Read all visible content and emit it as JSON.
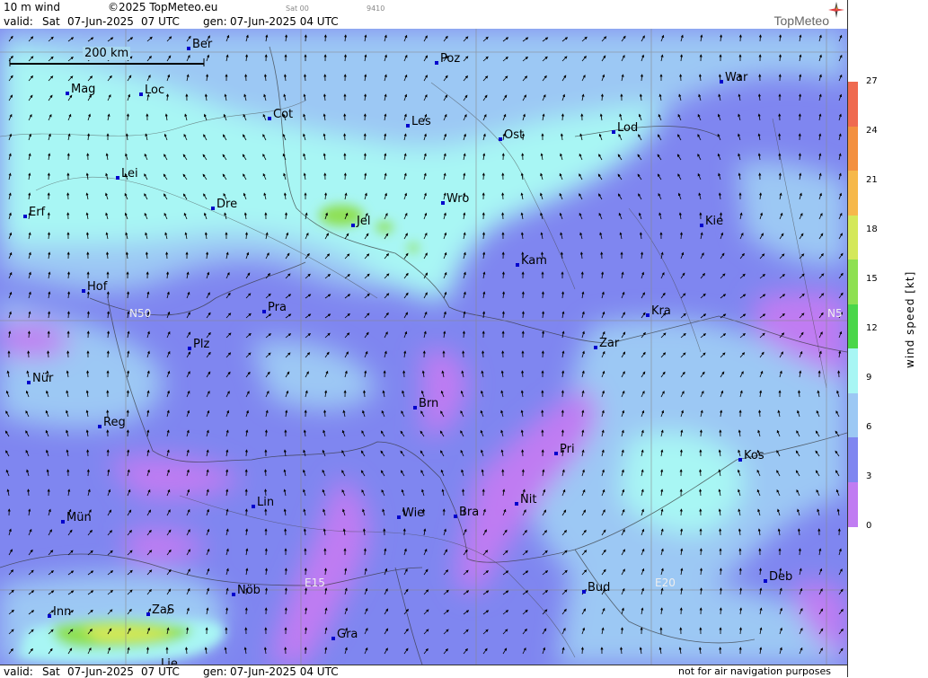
{
  "header": {
    "param": "10 m wind",
    "copyright": "©2025 TopMeteo.eu",
    "sat": "Sat 00",
    "code": "9410",
    "valid_label": "valid:",
    "valid_day": "Sat",
    "valid_date": "07-Jun-2025",
    "valid_time": "07 UTC",
    "gen_label": "gen:",
    "gen_date": "07-Jun-2025 04 UTC",
    "logo": "TopMeteo"
  },
  "footer": {
    "valid_label": "valid:",
    "valid_day": "Sat",
    "valid_date": "07-Jun-2025",
    "valid_time": "07 UTC",
    "gen_label": "gen:",
    "gen_date": "07-Jun-2025 04 UTC",
    "note": "not for air navigation purposes"
  },
  "scale_bar": "200 km",
  "grid_labels": {
    "n50_left": "N50",
    "n50_right": "N5",
    "e15": "E15",
    "e20": "E20"
  },
  "colorbar": {
    "title": "wind speed [kt]",
    "ticks": [
      "27",
      "24",
      "21",
      "18",
      "15",
      "12",
      "9",
      "6",
      "3",
      "0"
    ],
    "colors": [
      "#ef6a50",
      "#f39040",
      "#f6b84a",
      "#d4e85a",
      "#8ee052",
      "#4ad64a",
      "#a8f6f4",
      "#9cc8f4",
      "#7f86f0",
      "#c07cf2"
    ]
  },
  "cities": [
    {
      "name": "Ber"
    },
    {
      "name": "Poz"
    },
    {
      "name": "War"
    },
    {
      "name": "Mag"
    },
    {
      "name": "Loc"
    },
    {
      "name": "Cot"
    },
    {
      "name": "Les"
    },
    {
      "name": "Ost"
    },
    {
      "name": "Lod"
    },
    {
      "name": "Lei"
    },
    {
      "name": "Dre"
    },
    {
      "name": "Jel"
    },
    {
      "name": "Wro"
    },
    {
      "name": "Erf"
    },
    {
      "name": "Kie"
    },
    {
      "name": "Kam"
    },
    {
      "name": "Hof"
    },
    {
      "name": "Pra"
    },
    {
      "name": "Kra"
    },
    {
      "name": "Plz"
    },
    {
      "name": "Zar"
    },
    {
      "name": "Nür"
    },
    {
      "name": "Brn"
    },
    {
      "name": "Reg"
    },
    {
      "name": "Pri"
    },
    {
      "name": "Kos"
    },
    {
      "name": "Lin"
    },
    {
      "name": "Nit"
    },
    {
      "name": "Wie"
    },
    {
      "name": "Bra"
    },
    {
      "name": "Mün"
    },
    {
      "name": "Nöb"
    },
    {
      "name": "Bud"
    },
    {
      "name": "Deb"
    },
    {
      "name": "Inn"
    },
    {
      "name": "ZaS"
    },
    {
      "name": "Gra"
    },
    {
      "name": "Lie"
    }
  ]
}
